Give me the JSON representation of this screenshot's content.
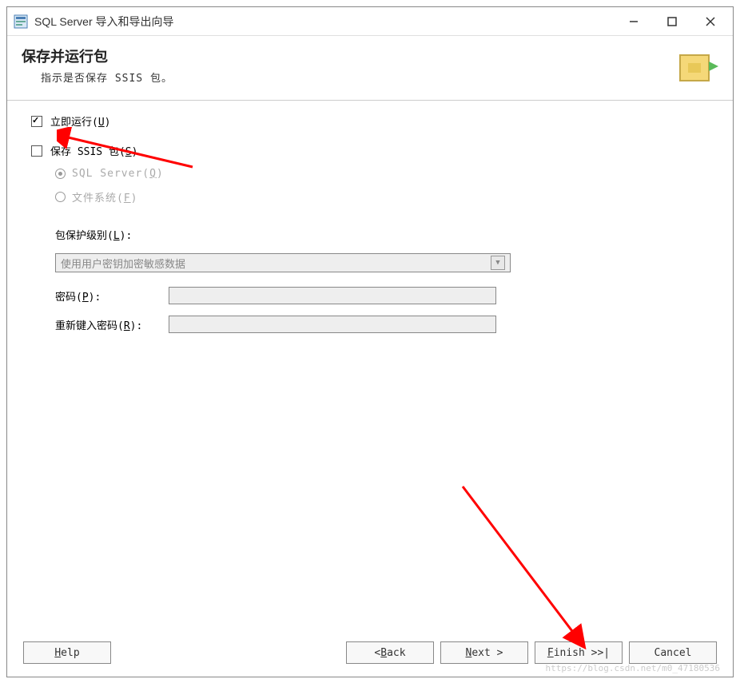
{
  "titlebar": {
    "title": "SQL Server 导入和导出向导"
  },
  "header": {
    "title": "保存并运行包",
    "subtitle": "指示是否保存 SSIS 包。"
  },
  "options": {
    "run_now_label": "立即运行(",
    "run_now_mnemonic": "U",
    "run_now_suffix": ")",
    "save_ssis_label": "保存 SSIS 包(",
    "save_ssis_mnemonic": "S",
    "save_ssis_suffix": ")",
    "sql_server_label": "SQL Server(",
    "sql_server_mnemonic": "Q",
    "sql_server_suffix": ")",
    "filesystem_label": "文件系统(",
    "filesystem_mnemonic": "F",
    "filesystem_suffix": ")"
  },
  "protection": {
    "level_label": "包保护级别(",
    "level_mnemonic": "L",
    "level_suffix": "):",
    "level_value": "使用用户密钥加密敏感数据",
    "password_label": "密码(",
    "password_mnemonic": "P",
    "password_suffix": "):",
    "retype_label": "重新键入密码(",
    "retype_mnemonic": "R",
    "retype_suffix": "):"
  },
  "buttons": {
    "help": "Help",
    "back": "< Back",
    "next": "Next >",
    "finish": "Finish >>|",
    "cancel": "Cancel"
  },
  "watermark": "https://blog.csdn.net/m0_47180536"
}
